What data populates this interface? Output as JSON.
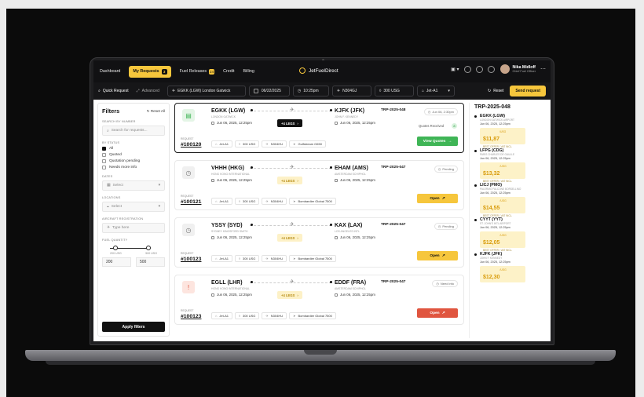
{
  "nav": {
    "items": [
      {
        "label": "Dashboard",
        "active": false,
        "badge": ""
      },
      {
        "label": "My Requests",
        "active": true,
        "badge": "3"
      },
      {
        "label": "Fuel Releases",
        "active": false,
        "badge": "24"
      },
      {
        "label": "Credit",
        "active": false,
        "badge": ""
      },
      {
        "label": "Billing",
        "active": false,
        "badge": ""
      }
    ],
    "brand": "JetFuelDirect",
    "user_name": "Nika Midloff",
    "user_role": "Chief Fuel Officer"
  },
  "search": {
    "quick_label": "Quick Request",
    "advanced_label": "Advanced",
    "airport": "EGKK (LGW) London Gatwick",
    "date": "06/22/2025",
    "time": "10:25pm",
    "tail": "N304GJ",
    "qty": "300 USG",
    "fuel": "Jet-A1",
    "reset_label": "Reset",
    "send_label": "Send request"
  },
  "filters": {
    "title": "Filters",
    "reset_label": "Reset All",
    "search_label": "Search by number",
    "search_placeholder": "Search for requests...",
    "status_label": "By status",
    "statuses": [
      {
        "label": "All",
        "checked": true
      },
      {
        "label": "Quoted",
        "checked": false
      },
      {
        "label": "Quotation pending",
        "checked": false
      },
      {
        "label": "Needs more info",
        "checked": false
      }
    ],
    "dates_label": "Dates",
    "dates_value": "Select",
    "locations_label": "Locations",
    "locations_value": "Select",
    "aircraft_label": "Aircraft registration",
    "aircraft_placeholder": "Type here",
    "fuel_label": "Fuel quantity",
    "min_label": "200 USG",
    "max_label": "500 USG",
    "min_value": "200",
    "max_value": "500",
    "apply_label": "Apply filters"
  },
  "requests": [
    {
      "number": "#100120",
      "num_label": "REQUEST",
      "from_code": "EGKK (LGW)",
      "from_name": "London Gatwick",
      "from_time": "Jun 06, 2025, 12:25pm",
      "to_code": "KJFK (JFK)",
      "to_name": "John F. Kennedy",
      "to_time": "Jun 06, 2025, 12:25pm",
      "legs": "+4 LEGS",
      "legs_style": "dark",
      "trip": "TRP-2025-048",
      "status": "Jun 06, 2:30pm",
      "quotes_label": "Quotes Received",
      "quotes": "8",
      "fuel": "Jet-A1",
      "qty": "300 USG",
      "tail": "N304HU",
      "aircraft": "Gulfstream G650",
      "action": "View Quotes",
      "action_style": "green",
      "icon_bg": "#e4f5e6",
      "icon_color": "#3fb556"
    },
    {
      "number": "#100121",
      "num_label": "REQUEST",
      "from_code": "VHHH (HKG)",
      "from_name": "Hong Kong International",
      "from_time": "Jun 06, 2025, 12:25pm",
      "to_code": "EHAM (AMS)",
      "to_name": "Amsterdam Schiphol",
      "to_time": "Jun 06, 2025, 12:25pm",
      "legs": "+4 LEGS",
      "legs_style": "light",
      "trip": "TRP-2025-047",
      "status": "Pending",
      "quotes_label": "",
      "quotes": "",
      "fuel": "Jet-A1",
      "qty": "300 USG",
      "tail": "N304HU",
      "aircraft": "Bombardier Global 7500",
      "action": "Open",
      "action_style": "yellow",
      "icon_bg": "#f0f0f0",
      "icon_color": "#777777"
    },
    {
      "number": "#100123",
      "num_label": "REQUEST",
      "from_code": "YSSY (SYD)",
      "from_name": "Sydney Kingsford Smith",
      "from_time": "Jun 06, 2025, 12:25pm",
      "to_code": "KAX (LAX)",
      "to_name": "Los Angeles Intl",
      "to_time": "Jun 06, 2025, 12:25pm",
      "legs": "+4 LEGS",
      "legs_style": "light",
      "trip": "TRP-2025-047",
      "status": "Pending",
      "quotes_label": "",
      "quotes": "",
      "fuel": "Jet-A1",
      "qty": "300 USG",
      "tail": "N304HU",
      "aircraft": "Bombardier Global 7500",
      "action": "Open",
      "action_style": "yellow",
      "icon_bg": "#f0f0f0",
      "icon_color": "#777777"
    },
    {
      "number": "#100123",
      "num_label": "REQUEST",
      "from_code": "EGLL (LHR)",
      "from_name": "Hong Kong International",
      "from_time": "Jun 06, 2025, 12:25pm",
      "to_code": "EDDF (FRA)",
      "to_name": "Amsterdam Schiphol",
      "to_time": "Jun 06, 2025, 12:25pm",
      "legs": "+4 LEGS",
      "legs_style": "light",
      "trip": "TRP-2025-047",
      "status": "Need info",
      "quotes_label": "",
      "quotes": "",
      "fuel": "Jet-A1",
      "qty": "300 USG",
      "tail": "N304HU",
      "aircraft": "Bombardier Global 7500",
      "action": "Open",
      "action_style": "red",
      "icon_bg": "#fde5df",
      "icon_color": "#e0553f"
    }
  ],
  "trip": {
    "title": "TRP-2025-048",
    "legs": [
      {
        "code": "EGKK (LGW)",
        "name": "London Gatwick Airport",
        "date": "Jun 06, 2025, 12:25pm",
        "price": "$11,87",
        "cents": "/USG",
        "note": "BEST OFFER / VAT INCL."
      },
      {
        "code": "LFPG (CDG)",
        "name": "Paris Charles de Gaulle",
        "date": "Jun 06, 2025, 12:25pm",
        "price": "$13,32",
        "cents": "/USG",
        "note": "BEST OFFER / VAT INCL."
      },
      {
        "code": "LICJ (PMO)",
        "name": "Palermo Falcone Borsellino",
        "date": "Jun 06, 2025, 12:25pm",
        "price": "$14,55",
        "cents": "/USG",
        "note": "BEST OFFER / VAT INCL."
      },
      {
        "code": "CYYT (YYT)",
        "name": "St. John's Intl Airport",
        "date": "Jun 06, 2025, 12:25pm",
        "price": "$12,05",
        "cents": "/USG",
        "note": "BEST OFFER / VAT INCL."
      },
      {
        "code": "KJFK (JFK)",
        "name": "John F. Kennedy",
        "date": "Jun 06, 2025, 12:25pm",
        "price": "$12,30",
        "cents": "/USG",
        "note": ""
      }
    ]
  }
}
